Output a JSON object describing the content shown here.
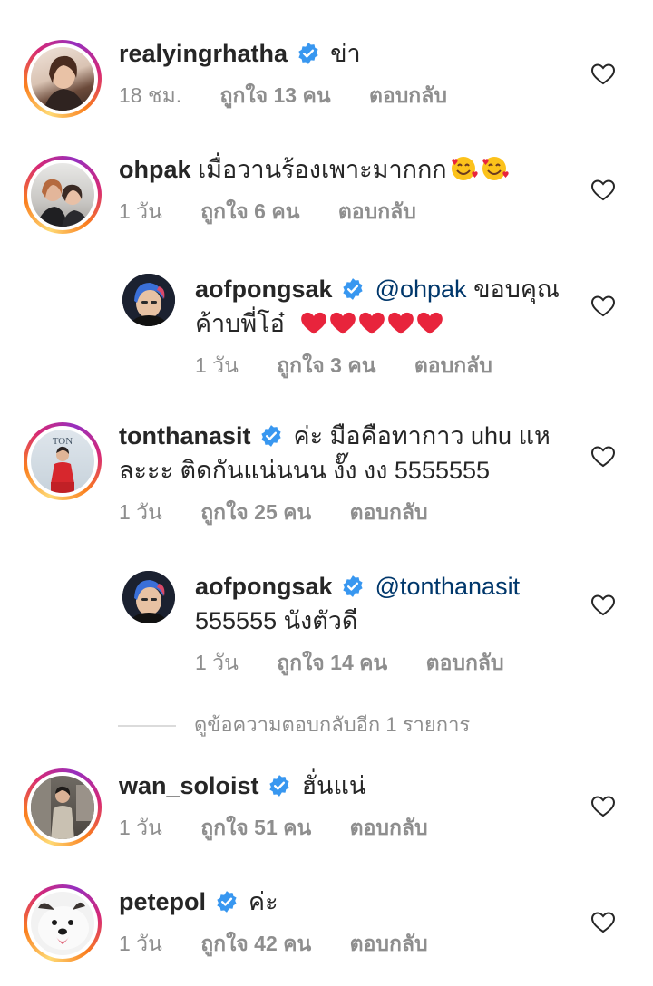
{
  "comments": [
    {
      "username": "realyingrhatha",
      "verified": true,
      "text_line1": "ข่า",
      "text_line2": "",
      "time": "18 ชม.",
      "likes": "ถูกใจ 13 คน",
      "reply": "ตอบกลับ",
      "avatar_icon": "woman-portrait-avatar"
    },
    {
      "username": "ohpak",
      "verified": false,
      "text_line1": "เมื่อวานร้องเพาะมากกก",
      "text_line2": "",
      "time": "1 วัน",
      "likes": "ถูกใจ 6 คน",
      "reply": "ตอบกลับ",
      "avatar_icon": "two-people-car-avatar",
      "emoji": "smiling-face-with-hearts"
    },
    {
      "username": "aofpongsak",
      "verified": true,
      "mention": "@ohpak",
      "text_line1": "ขอบคุณ",
      "text_line2": "ค้าบพี่โอ๋",
      "time": "1 วัน",
      "likes": "ถูกใจ 3 คน",
      "reply": "ตอบกลับ",
      "avatar_icon": "man-blue-hair-avatar",
      "emoji": "red-heart"
    },
    {
      "username": "tonthanasit",
      "verified": true,
      "text_line1": "ค่ะ มือคือทากาว uhu แห",
      "text_line2": "ละะะ ติดกันแน่นนน งั๊ง งง 5555555",
      "time": "1 วัน",
      "likes": "ถูกใจ 25 คน",
      "reply": "ตอบกลับ",
      "avatar_icon": "man-red-suit-avatar"
    },
    {
      "username": "aofpongsak",
      "verified": true,
      "mention": "@tonthanasit",
      "text_line1": "",
      "text_line2": "555555 นังตัวดี",
      "time": "1 วัน",
      "likes": "ถูกใจ 14 คน",
      "reply": "ตอบกลับ",
      "avatar_icon": "man-blue-hair-avatar"
    },
    {
      "username": "wan_soloist",
      "verified": true,
      "text_line1": "ฮั่นแน่",
      "text_line2": "",
      "time": "1 วัน",
      "likes": "ถูกใจ 51 คน",
      "reply": "ตอบกลับ",
      "avatar_icon": "man-standing-avatar"
    },
    {
      "username": "petepol",
      "verified": true,
      "text_line1": "ค่ะ",
      "text_line2": "",
      "time": "1 วัน",
      "likes": "ถูกใจ 42 คน",
      "reply": "ตอบกลับ",
      "avatar_icon": "dog-avatar"
    }
  ],
  "more_replies": "ดูข้อความตอบกลับอีก 1 รายการ",
  "colors": {
    "text": "#262626",
    "meta": "#8e8e8e",
    "mention": "#00376b",
    "verified": "#3897f0",
    "heart": "#ed4956"
  }
}
